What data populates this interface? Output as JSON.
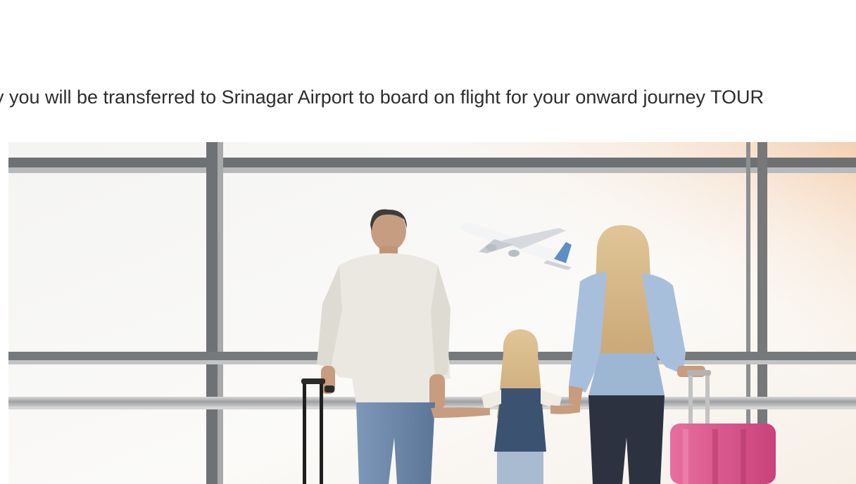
{
  "content": {
    "description": "y you will be transferred to Srinagar Airport to board on flight for your onward journey TOUR"
  },
  "image": {
    "semantic": "family-at-airport-window-photo"
  },
  "colors": {
    "text": "#2c2c2c",
    "window_frame": "#6f7274",
    "suitcase": "#d9548a"
  }
}
